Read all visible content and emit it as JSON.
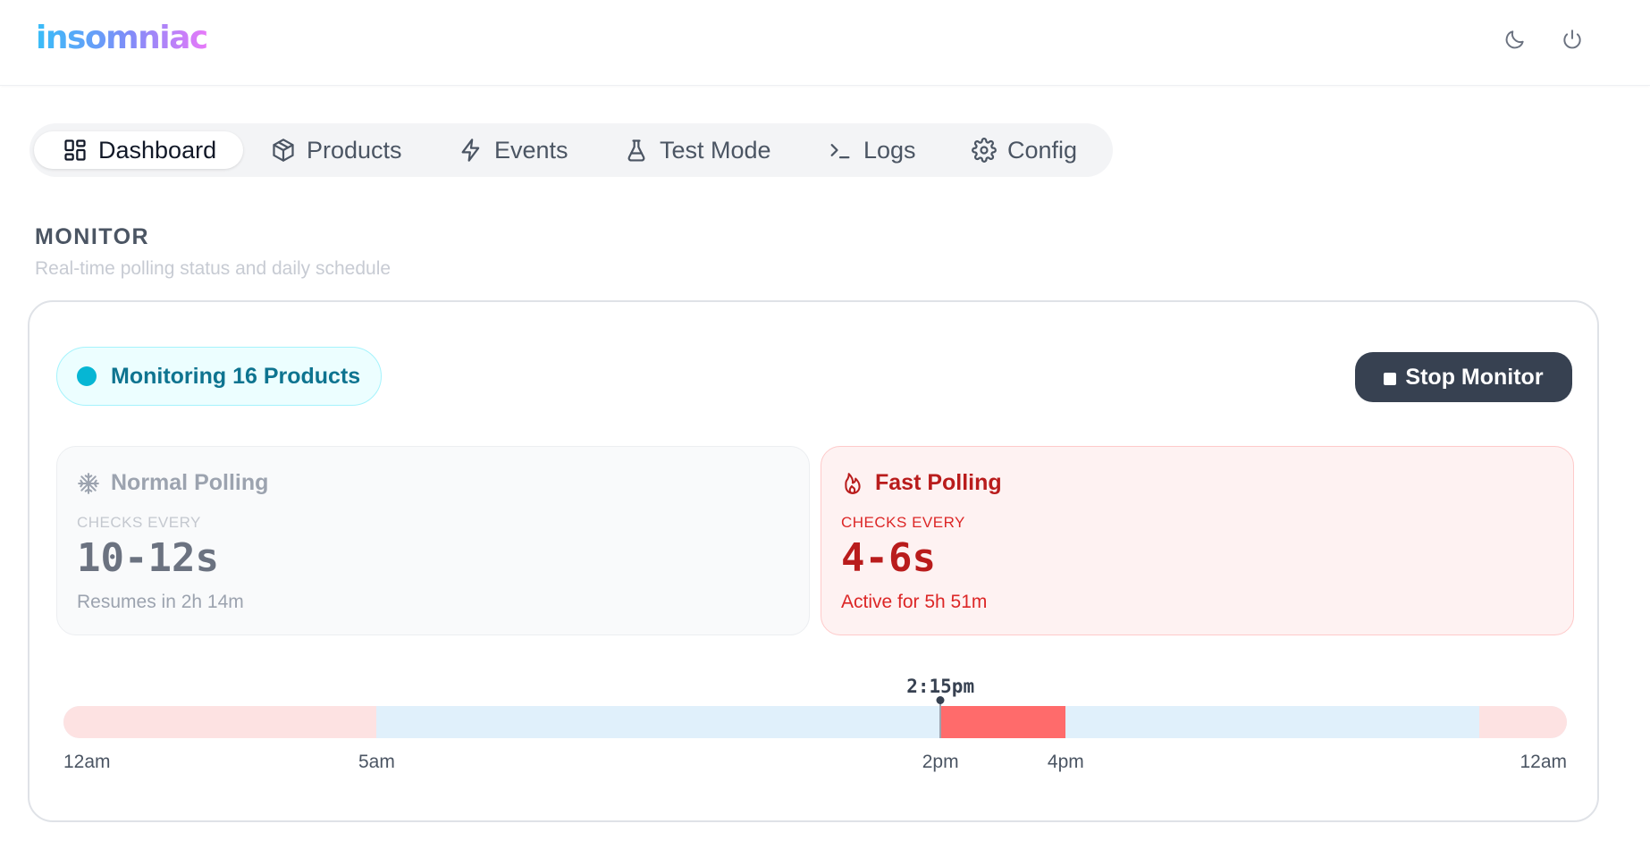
{
  "app": {
    "logo": "insomniac"
  },
  "header": {
    "icons": [
      "moon-icon",
      "power-icon"
    ]
  },
  "tabs": [
    {
      "label": "Dashboard",
      "icon": "dashboard-grid-icon",
      "active": true
    },
    {
      "label": "Products",
      "icon": "box-icon",
      "active": false
    },
    {
      "label": "Events",
      "icon": "lightning-icon",
      "active": false
    },
    {
      "label": "Test Mode",
      "icon": "flask-icon",
      "active": false
    },
    {
      "label": "Logs",
      "icon": "terminal-icon",
      "active": false
    },
    {
      "label": "Config",
      "icon": "gear-icon",
      "active": false
    }
  ],
  "section": {
    "title": "MONITOR",
    "subtitle": "Real-time polling status and daily schedule"
  },
  "monitor": {
    "status": "Monitoring 16 Products",
    "stop_label": "Stop Monitor"
  },
  "polling": {
    "normal": {
      "title": "Normal Polling",
      "icon": "snowflake-icon",
      "checks_label": "CHECKS EVERY",
      "interval": "10-12s",
      "note": "Resumes in 2h 14m"
    },
    "fast": {
      "title": "Fast Polling",
      "icon": "flame-icon",
      "checks_label": "CHECKS EVERY",
      "interval": "4-6s",
      "note": "Active for 5h 51m"
    }
  },
  "timeline": {
    "now_label": "2:15pm",
    "now_hour": 14.0,
    "segments": [
      {
        "start": 0,
        "end": 5,
        "kind": "fast-off",
        "color": "#fde2e2"
      },
      {
        "start": 5,
        "end": 14,
        "kind": "normal",
        "color": "#e0f0fb"
      },
      {
        "start": 14,
        "end": 16,
        "kind": "fast-active",
        "color": "#ff6b6b"
      },
      {
        "start": 16,
        "end": 22.6,
        "kind": "normal",
        "color": "#e0f0fb"
      },
      {
        "start": 22.6,
        "end": 24,
        "kind": "fast-off",
        "color": "#fde2e2"
      }
    ],
    "ticks": [
      {
        "label": "12am",
        "hour": 0
      },
      {
        "label": "5am",
        "hour": 5
      },
      {
        "label": "2pm",
        "hour": 14
      },
      {
        "label": "4pm",
        "hour": 16
      },
      {
        "label": "12am",
        "hour": 24
      }
    ]
  }
}
